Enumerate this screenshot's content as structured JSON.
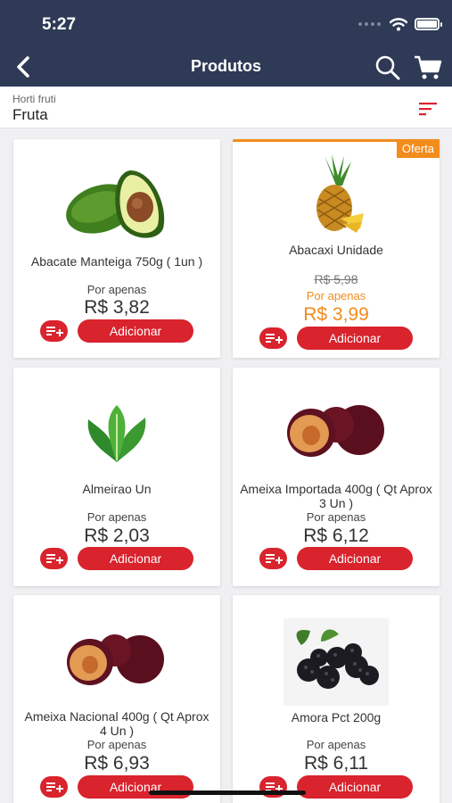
{
  "status_bar": {
    "time": "5:27"
  },
  "nav": {
    "title": "Produtos",
    "back_icon": "chevron-left-icon",
    "search_icon": "search-icon",
    "cart_icon": "cart-icon"
  },
  "subheader": {
    "breadcrumb": "Horti fruti",
    "category": "Fruta",
    "filter_icon": "sort-filter-icon"
  },
  "colors": {
    "header": "#2e3a56",
    "accent_red": "#d9232d",
    "offer_orange": "#f28c1c"
  },
  "products": [
    {
      "name": "Abacate Manteiga 750g ( 1un )",
      "label": "Por apenas",
      "price": "R$ 3,82",
      "button": "Adicionar"
    },
    {
      "name": "Abacaxi Unidade",
      "badge": "Oferta",
      "old_price": "R$ 5,98",
      "label": "Por apenas",
      "price": "R$ 3,99",
      "button": "Adicionar"
    },
    {
      "name": "Almeirao Un",
      "label": "Por apenas",
      "price": "R$ 2,03",
      "button": "Adicionar"
    },
    {
      "name": "Ameixa Importada 400g ( Qt Aprox 3 Un )",
      "label": "Por apenas",
      "price": "R$ 6,12",
      "button": "Adicionar"
    },
    {
      "name": "Ameixa Nacional 400g ( Qt Aprox 4 Un )",
      "label": "Por apenas",
      "price": "R$ 6,93",
      "button": "Adicionar"
    },
    {
      "name": "Amora Pct 200g",
      "label": "Por apenas",
      "price": "R$ 6,11",
      "button": "Adicionar"
    }
  ]
}
